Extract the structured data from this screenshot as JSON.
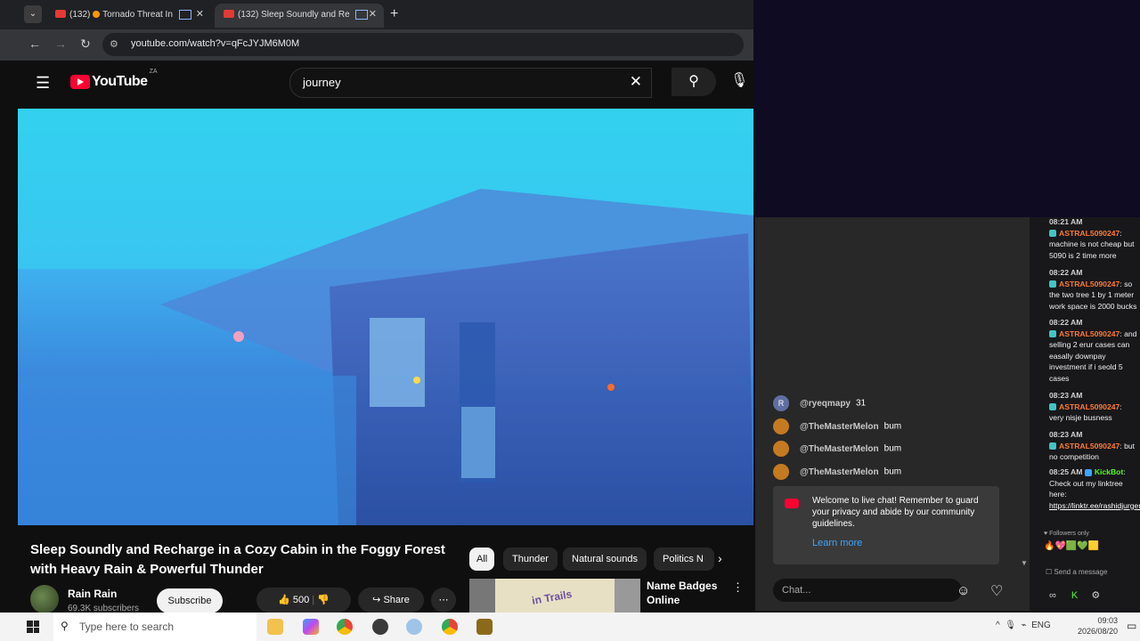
{
  "browser": {
    "tabs": [
      {
        "label": "(132)",
        "title": "Tornado Threat In"
      },
      {
        "label": "(132) Sleep Soundly and Re"
      }
    ],
    "url": "youtube.com/watch?v=qFcJYJM6M0M"
  },
  "youtube": {
    "region": "ZA",
    "logo_text": "YouTube",
    "search_query": "journey",
    "video_title": "Sleep Soundly and Recharge in a Cozy Cabin in the Foggy Forest with Heavy Rain & Powerful Thunder",
    "channel": {
      "name": "Rain Rain",
      "subscribers": "69.3K subscribers"
    },
    "subscribe_label": "Subscribe",
    "like_count": "500",
    "share_label": "Share",
    "chips": [
      "All",
      "Thunder",
      "Natural sounds",
      "Politics N"
    ],
    "recommendation": {
      "title": "Name Badges Online",
      "thumb_text": "in Trails"
    }
  },
  "youtube_chat": {
    "messages": [
      {
        "avatar": "R",
        "user": "@ryeqmapy",
        "text": "31"
      },
      {
        "avatar": "",
        "user": "@TheMasterMelon",
        "text": "bum"
      },
      {
        "avatar": "",
        "user": "@TheMasterMelon",
        "text": "bum"
      },
      {
        "avatar": "",
        "user": "@TheMasterMelon",
        "text": "bum"
      }
    ],
    "welcome_text": "Welcome to live chat! Remember to guard your privacy and abide by our community guidelines.",
    "learn_more": "Learn more",
    "input_placeholder": "Chat..."
  },
  "kick_chat": {
    "messages": [
      {
        "time": "08:21 AM",
        "user": "ASTRAL5090247",
        "text": "machine is not cheap but 5090 is 2 time more"
      },
      {
        "time": "08:22 AM",
        "user": "ASTRAL5090247",
        "text": "so the two tree 1 by 1 meter work space is 2000 bucks"
      },
      {
        "time": "08:22 AM",
        "user": "ASTRAL5090247",
        "text": "and selling 2 erur cases can easally downpay investment if i seold 5 cases"
      },
      {
        "time": "08:23 AM",
        "user": "ASTRAL5090247",
        "text": "very nisje busness"
      },
      {
        "time": "08:23 AM",
        "user": "ASTRAL5090247",
        "text": "but no competition"
      },
      {
        "time": "08:25 AM",
        "user": "KickBot",
        "text": "Check out my linktree here:",
        "link": "https://linktr.ee/rashidjurgens"
      }
    ],
    "followers_only": "Followers only",
    "send_placeholder": "Send a message"
  },
  "taskbar": {
    "search_placeholder": "Type here to search",
    "lang": "ENG",
    "time": "09:03",
    "date": "2026/08/20"
  }
}
